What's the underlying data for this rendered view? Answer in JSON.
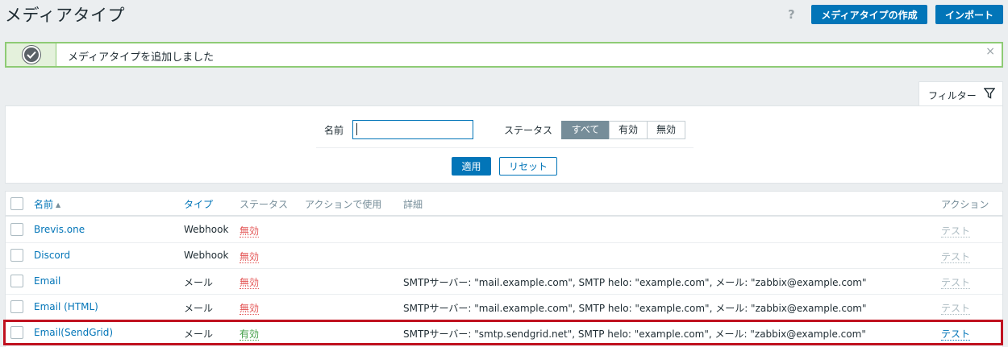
{
  "header": {
    "title": "メディアタイプ",
    "help": "?",
    "create_label": "メディアタイプの作成",
    "import_label": "インポート"
  },
  "message": {
    "text": "メディアタイプを追加しました",
    "close": "×",
    "icon": "check-circle-icon"
  },
  "filter": {
    "tab_label": "フィルター",
    "name_label": "名前",
    "name_value": "",
    "status_label": "ステータス",
    "status_options": [
      "すべて",
      "有効",
      "無効"
    ],
    "status_selected": "すべて",
    "apply_label": "適用",
    "reset_label": "リセット"
  },
  "table": {
    "columns": {
      "name": "名前",
      "type": "タイプ",
      "status": "ステータス",
      "used_in_actions": "アクションで使用",
      "details": "詳細",
      "actions": "アクション"
    },
    "sort_indicator": "▲",
    "rows": [
      {
        "name": "Brevis.one",
        "type": "Webhook",
        "status": "無効",
        "details": "",
        "action": "テスト"
      },
      {
        "name": "Discord",
        "type": "Webhook",
        "status": "無効",
        "details": "",
        "action": "テスト"
      },
      {
        "name": "Email",
        "type": "メール",
        "status": "無効",
        "details": "SMTPサーバー: \"mail.example.com\", SMTP helo: \"example.com\", メール: \"zabbix@example.com\"",
        "action": "テスト"
      },
      {
        "name": "Email (HTML)",
        "type": "メール",
        "status": "無効",
        "details": "SMTPサーバー: \"mail.example.com\", SMTP helo: \"example.com\", メール: \"zabbix@example.com\"",
        "action": "テスト"
      },
      {
        "name": "Email(SendGrid)",
        "type": "メール",
        "status": "有効",
        "details": "SMTPサーバー: \"smtp.sendgrid.net\", SMTP helo: \"example.com\", メール: \"zabbix@example.com\"",
        "action": "テスト"
      }
    ]
  },
  "colors": {
    "primary": "#0275b8",
    "disabled": "#e45959",
    "enabled": "#429e47",
    "highlight": "#c0111f",
    "success_border": "#8ecb75"
  }
}
